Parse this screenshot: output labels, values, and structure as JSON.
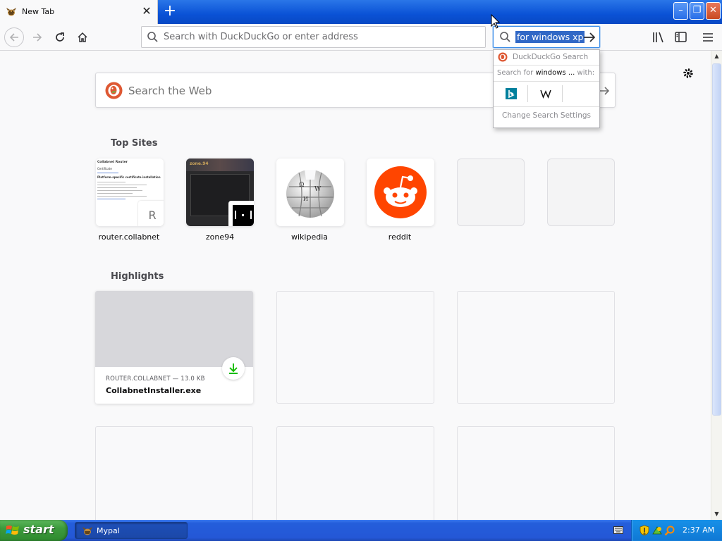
{
  "browser": {
    "tab": {
      "title": "New Tab",
      "close_symbol": "✕",
      "favicon": "mypal-icon"
    },
    "new_tab_symbol": "+",
    "window_controls": {
      "minimize": "–",
      "maximize": "❐",
      "close": "✕"
    },
    "url_bar": {
      "placeholder": "Search with DuckDuckGo or enter address",
      "value": ""
    },
    "search_bar": {
      "value": "for windows xp",
      "selected": true
    }
  },
  "search_popup": {
    "engine_label": "DuckDuckGo Search",
    "search_for_prefix": "Search for",
    "search_for_query": "windows ...",
    "search_for_suffix": "with:",
    "engines": [
      "Bing",
      "Wikipedia"
    ],
    "settings_label": "Change Search Settings"
  },
  "newtab": {
    "search_placeholder": "Search the Web",
    "top_sites_title": "Top Sites",
    "top_sites": [
      {
        "label": "router.collabnet",
        "badge": "R"
      },
      {
        "label": "zone94"
      },
      {
        "label": "wikipedia"
      },
      {
        "label": "reddit"
      },
      {
        "label": ""
      },
      {
        "label": ""
      }
    ],
    "highlights_title": "Highlights",
    "highlights": [
      {
        "meta": "ROUTER.COLLABNET — 13.0 KB",
        "name": "CollabnetInstaller.exe"
      }
    ],
    "collabnet_preview": {
      "heading": "Collabnet Router",
      "section": "Certificate",
      "subheading": "Platform-specific certificate installation"
    },
    "zone94_preview": {
      "logo": "zone.94"
    }
  },
  "taskbar": {
    "start_label": "start",
    "task_label": "Mypal",
    "clock": "2:37 AM"
  },
  "colors": {
    "titlebar_blue": "#0a52d6",
    "selection": "#3168c6",
    "reddit": "#ff4500",
    "duckduckgo": "#de5833",
    "download_green": "#12bc00"
  }
}
